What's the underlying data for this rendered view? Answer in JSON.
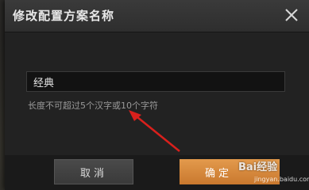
{
  "dialog": {
    "title": "修改配置方案名称",
    "input_value": "经典",
    "hint": "长度不可超过5个汉字或10个字符",
    "cancel_label": "取消",
    "ok_label": "确定"
  },
  "watermark": {
    "brand": "Bai经验",
    "url": "jingyan.baidu.com"
  },
  "icons": {
    "close": "close-icon",
    "annotation": "red-arrow-annotation"
  },
  "colors": {
    "accent": "#d88a3e",
    "annotation": "#d9201c"
  }
}
